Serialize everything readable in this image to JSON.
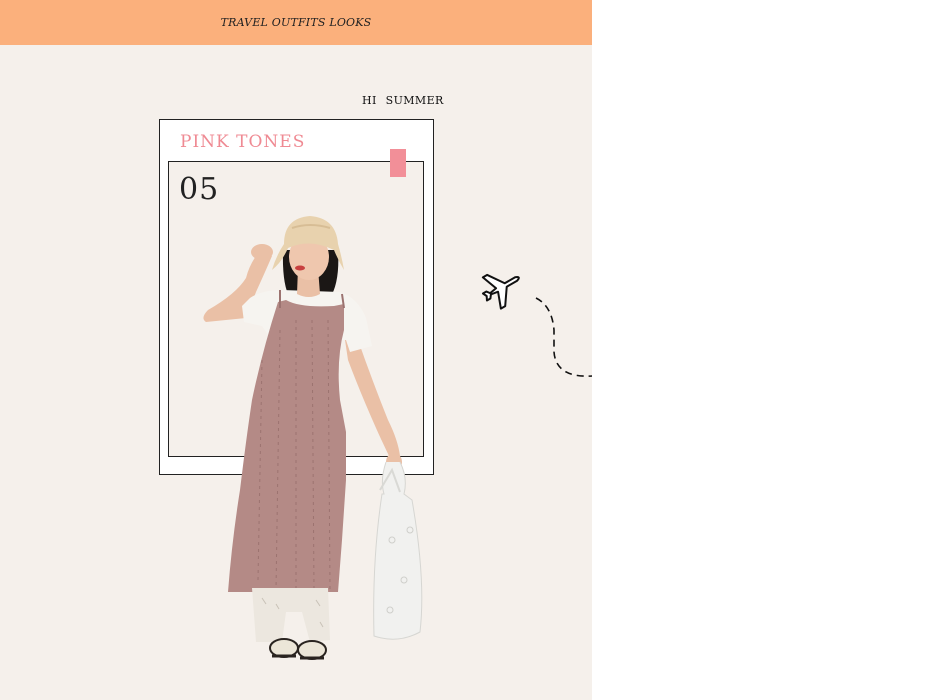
{
  "banner": {
    "title": "TRAVEL OUTFITS LOOKS"
  },
  "tagline": "HI  SUMMER",
  "card": {
    "heading": "PINK TONES",
    "number": "05"
  },
  "colors": {
    "banner": "#fbb07c",
    "background": "#f5f0eb",
    "accent": "#f28f98",
    "dress": "#b48a86"
  },
  "icons": [
    "airplane-icon",
    "dashed-flight-path"
  ]
}
